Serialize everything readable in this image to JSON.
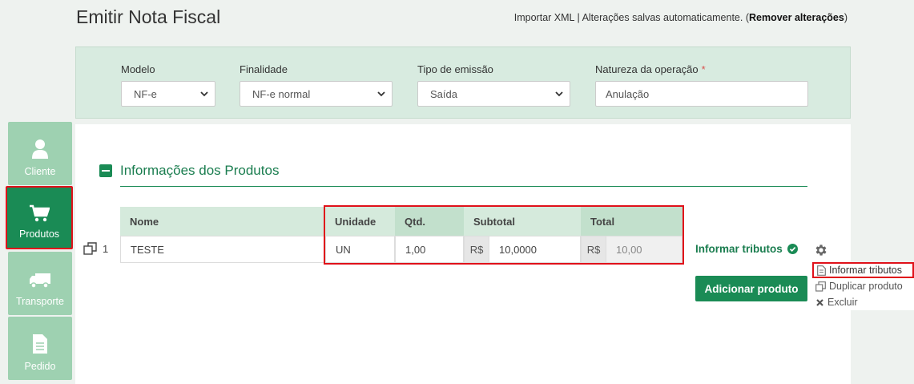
{
  "header": {
    "title": "Emitir Nota Fiscal",
    "import_xml": "Importar XML",
    "separator": "|",
    "autosave_text": "Alterações salvas automaticamente. (",
    "remove_changes": "Remover alterações",
    "close_paren": ")"
  },
  "filters": {
    "modelo": {
      "label": "Modelo",
      "value": "NF-e"
    },
    "finalidade": {
      "label": "Finalidade",
      "value": "NF-e normal"
    },
    "tipo_emissao": {
      "label": "Tipo de emissão",
      "value": "Saída"
    },
    "natureza": {
      "label": "Natureza da operação",
      "required_mark": "*",
      "value": "Anulação"
    }
  },
  "sidebar": {
    "items": [
      {
        "label": "Cliente",
        "icon": "user-icon",
        "active": false
      },
      {
        "label": "Produtos",
        "icon": "cart-icon",
        "active": true
      },
      {
        "label": "Transporte",
        "icon": "truck-icon",
        "active": false
      },
      {
        "label": "Pedido",
        "icon": "document-icon",
        "active": false
      }
    ]
  },
  "products": {
    "section_title": "Informações dos Produtos",
    "columns": [
      "Nome",
      "Unidade",
      "Qtd.",
      "Subtotal",
      "Total"
    ],
    "rows": [
      {
        "index": "1",
        "nome": "TESTE",
        "unidade": "UN",
        "qtd": "1,00",
        "subtotal_prefix": "R$",
        "subtotal": "10,0000",
        "total_prefix": "R$",
        "total": "10,00"
      }
    ],
    "informar_tributos": "Informar tributos",
    "add_button": "Adicionar produto"
  },
  "row_menu": {
    "items": [
      {
        "label": "Informar tributos",
        "icon": "document-icon"
      },
      {
        "label": "Duplicar produto",
        "icon": "copy-icon"
      },
      {
        "label": "Excluir",
        "icon": "close-icon"
      }
    ]
  },
  "colors": {
    "primary": "#1a8b55",
    "sidebar_inactive": "#9ed1b1",
    "highlight": "#e0111a"
  }
}
